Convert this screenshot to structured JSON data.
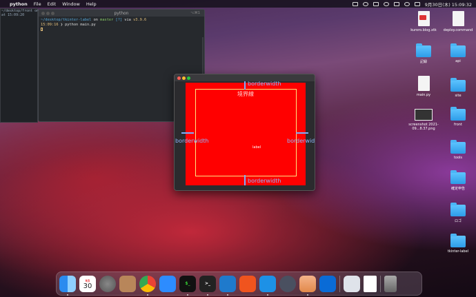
{
  "menubar": {
    "app": "python",
    "items": [
      "File",
      "Edit",
      "Window",
      "Help"
    ],
    "datetime": "9月30日(木) 15:09:32"
  },
  "term_back": {
    "line1": "~/desktop/front on",
    "line2": "at 15:09:20"
  },
  "terminal": {
    "title": "python",
    "shortcut": "⌥⌘1",
    "prompt_path": "~/desktop/tkinter-label",
    "prompt_on": "on",
    "branch": "master",
    "branch_status": "[?]",
    "via": "via",
    "py_version": "v3.9.6",
    "time": "15:09:16",
    "command": "❯ python main.py"
  },
  "tkwin": {
    "label_text": "label",
    "border_top": "borderwidth",
    "boundary": "境界線",
    "border_left": "borderwidth",
    "border_right": "borderwidth",
    "border_bottom": "borderwidth"
  },
  "desktop": {
    "items": [
      {
        "name": "kuroro.blog.xtk",
        "type": "file"
      },
      {
        "name": "deploy.command",
        "type": "file"
      },
      {
        "name": "記録",
        "type": "folder"
      },
      {
        "name": "api",
        "type": "folder"
      },
      {
        "name": "main.py",
        "type": "file"
      },
      {
        "name": "site",
        "type": "folder"
      },
      {
        "name": "screenshot 2021-09...8.37.png",
        "type": "shot"
      },
      {
        "name": "front",
        "type": "folder"
      },
      {
        "name": "tools",
        "type": "folder"
      },
      {
        "name": "確定申告",
        "type": "folder"
      },
      {
        "name": "ロゴ",
        "type": "folder"
      },
      {
        "name": "tkinter-label",
        "type": "folder"
      }
    ]
  },
  "dock": {
    "calendar_month": "9月",
    "calendar_day": "30",
    "apps": [
      "finder-icon",
      "calendar-icon",
      "system-preferences-icon",
      "contacts-icon",
      "chrome-icon",
      "zoom-icon",
      "terminal-icon",
      "terminal-icon",
      "vscode-icon",
      "analytics-icon",
      "docker-icon",
      "quicktime-icon",
      "preview-icon",
      "infinity-icon",
      "screenshot-icon",
      "document-icon",
      "trash-icon"
    ]
  }
}
